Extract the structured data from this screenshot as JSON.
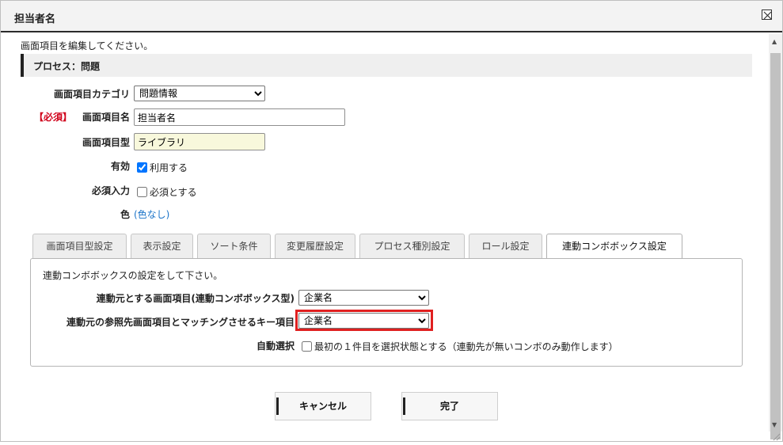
{
  "dialog": {
    "title": "担当者名",
    "close_icon": "close-icon"
  },
  "form": {
    "intro": "画面項目を編集してください。",
    "process_label": "プロセス：問題",
    "category": {
      "label": "画面項目カテゴリ",
      "value": "問題情報"
    },
    "item_name": {
      "required": "【必須】",
      "label": "画面項目名",
      "value": "担当者名"
    },
    "item_type": {
      "label": "画面項目型",
      "value": "ライブラリ"
    },
    "enabled": {
      "label": "有効",
      "option": "利用する",
      "checked": true
    },
    "required_input": {
      "label": "必須入力",
      "option": "必須とする",
      "checked": false
    },
    "color": {
      "label": "色",
      "value": "(色なし)"
    }
  },
  "tabs": [
    {
      "label": "画面項目型設定"
    },
    {
      "label": "表示設定"
    },
    {
      "label": "ソート条件"
    },
    {
      "label": "変更履歴設定"
    },
    {
      "label": "プロセス種別設定"
    },
    {
      "label": "ロール設定"
    },
    {
      "label": "連動コンボボックス設定",
      "active": true
    }
  ],
  "panel": {
    "intro": "連動コンボボックスの設定をして下さい。",
    "source_item": {
      "label": "連動元とする画面項目(連動コンボボックス型)",
      "value": "企業名"
    },
    "key_item": {
      "label": "連動元の参照先画面項目とマッチングさせるキー項目",
      "value": "企業名"
    },
    "auto_select": {
      "label": "自動選択",
      "option": "最初の１件目を選択状態とする（連動先が無いコンボのみ動作します）",
      "checked": false
    }
  },
  "buttons": {
    "cancel": "キャンセル",
    "done": "完了"
  },
  "colors": {
    "required": "#d0021b",
    "link": "#1a73c8",
    "highlight": "#e02020"
  }
}
